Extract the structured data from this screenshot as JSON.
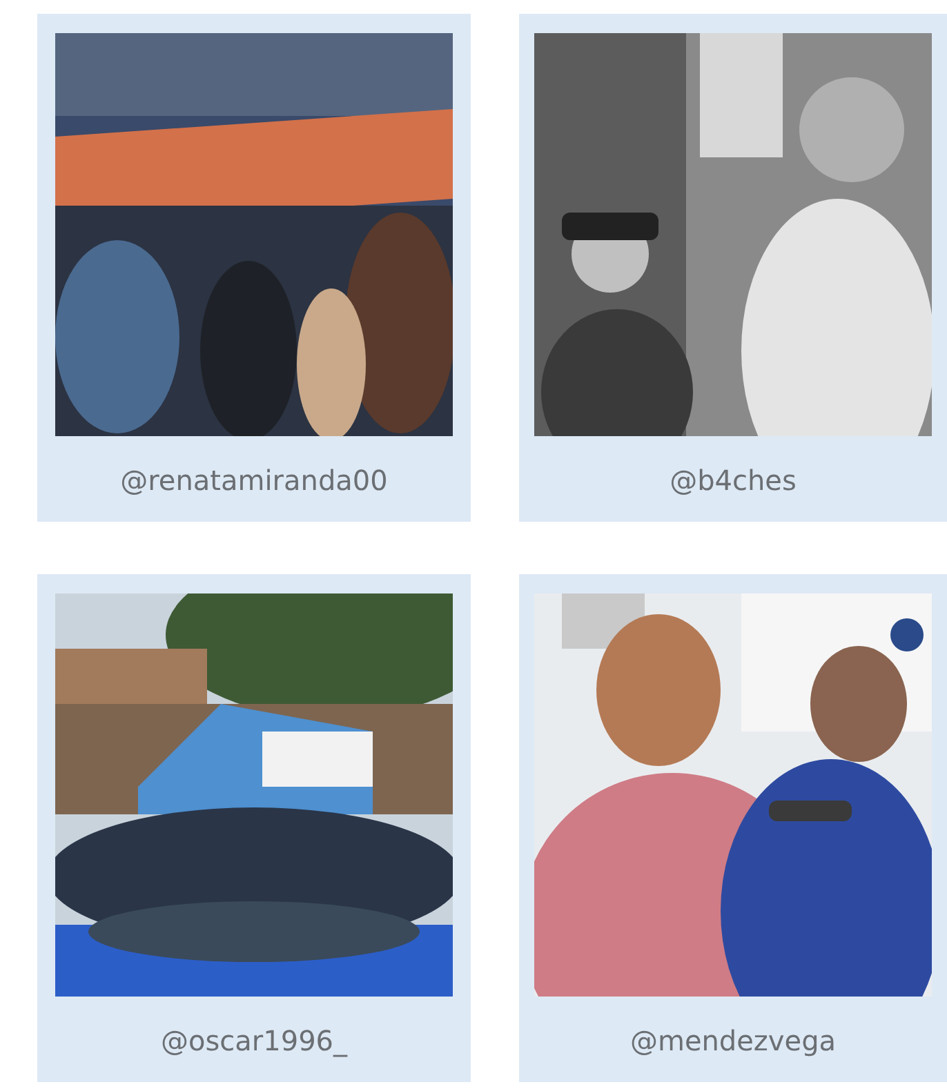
{
  "posts": [
    {
      "handle": "@renatamiranda00"
    },
    {
      "handle": "@b4ches"
    },
    {
      "handle": "@oscar1996_"
    },
    {
      "handle": "@mendezvega"
    }
  ]
}
